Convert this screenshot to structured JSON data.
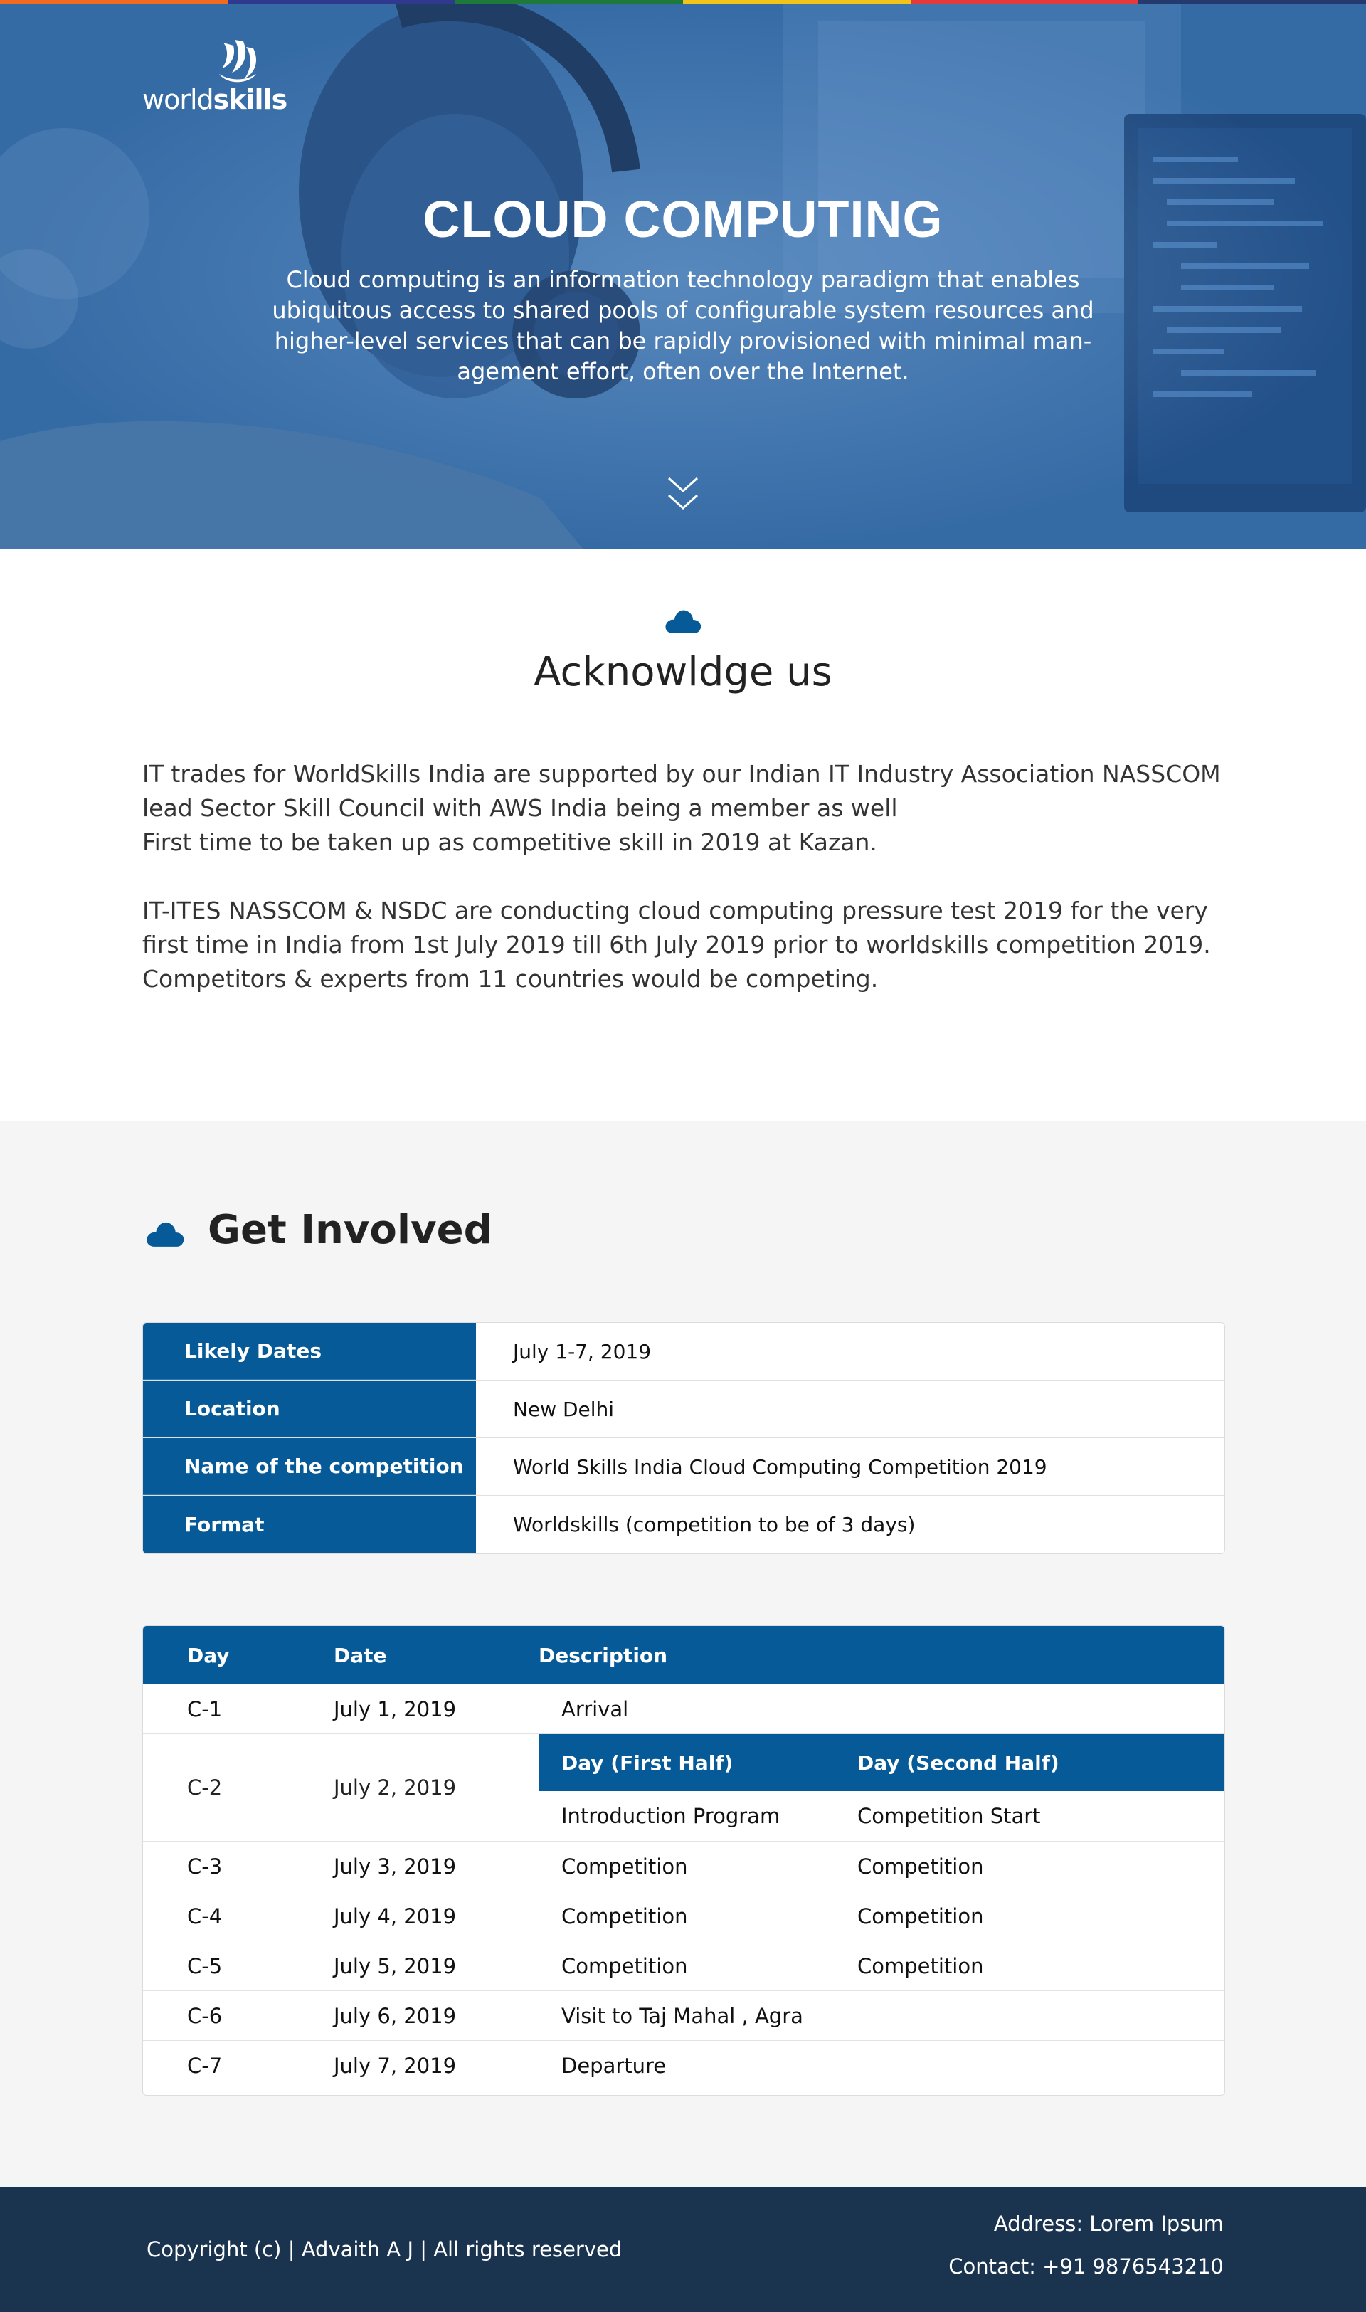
{
  "colors": {
    "strip": [
      "#f26b21",
      "#2f3a8f",
      "#1e7a3a",
      "#f2c318",
      "#e63a3a",
      "#243a6e"
    ],
    "brand_blue": "#065a98",
    "footer_bg": "#1a334f"
  },
  "hero": {
    "logo_light": "world",
    "logo_bold": "skills",
    "title": "CLOUD COMPUTING",
    "description_lines": [
      "Cloud computing is an information technology paradigm that enables",
      "ubiquitous access to shared pools of configurable system resources and",
      "higher-level services that can be rapidly provisioned with minimal man-",
      "agement effort, often over the Internet."
    ],
    "scroll_icon": "double-chevron-down-icon"
  },
  "acknowledge": {
    "icon": "cloud-icon",
    "title": "Acknowldge us",
    "para1_lines": [
      "IT trades for WorldSkills India are supported by our Indian IT Industry Association NASSCOM",
      "lead Sector Skill Council with AWS India being a member as well",
      "First time to be taken up as competitive skill in 2019 at Kazan."
    ],
    "para2_lines": [
      "IT-ITES NASSCOM & NSDC are conducting cloud computing pressure test 2019 for the very",
      "first time in India from 1st July 2019 till 6th July 2019 prior to worldskills competition 2019.",
      "Competitors & experts from 11 countries would be competing."
    ]
  },
  "involved": {
    "icon": "cloud-icon",
    "title": "Get Involved",
    "info": [
      {
        "key": "Likely Dates",
        "value": "July 1-7, 2019"
      },
      {
        "key": "Location",
        "value": "New Delhi"
      },
      {
        "key": "Name of the competition",
        "value": "World Skills India Cloud Computing Competition 2019"
      },
      {
        "key": "Format",
        "value": "Worldskills (competition to be of 3 days)"
      }
    ],
    "schedule": {
      "headers": {
        "day": "Day",
        "date": "Date",
        "description": "Description"
      },
      "c1": {
        "day": "C-1",
        "date": "July 1, 2019",
        "desc": "Arrival"
      },
      "c2": {
        "day": "C-2",
        "date": "July 2, 2019",
        "first_half_header": "Day (First Half)",
        "second_half_header": "Day (Second Half)",
        "first_half": "Introduction Program",
        "second_half": "Competition Start"
      },
      "c3": {
        "day": "C-3",
        "date": "July 3, 2019",
        "first": "Competition",
        "second": "Competition"
      },
      "c4": {
        "day": "C-4",
        "date": "July 4, 2019",
        "first": "Competition",
        "second": "Competition"
      },
      "c5": {
        "day": "C-5",
        "date": "July 5, 2019",
        "first": "Competition",
        "second": "Competition"
      },
      "c6": {
        "day": "C-6",
        "date": "July 6, 2019",
        "desc": "Visit to Taj Mahal , Agra"
      },
      "c7": {
        "day": "C-7",
        "date": "July 7, 2019",
        "desc": "Departure"
      }
    }
  },
  "footer": {
    "copyright": "Copyright (c) | Advaith A J | All rights reserved",
    "address": "Address: Lorem Ipsum",
    "contact": "Contact: +91 9876543210"
  }
}
